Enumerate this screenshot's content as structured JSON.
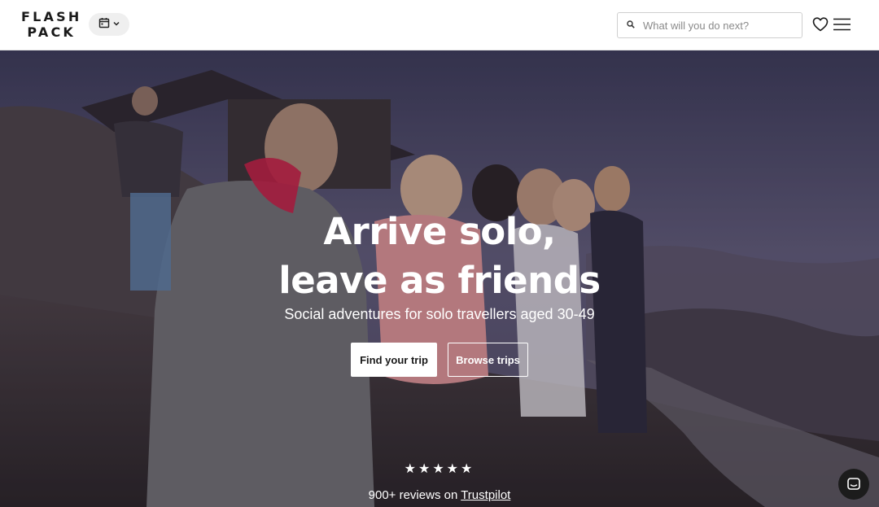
{
  "header": {
    "logo": {
      "line1": "FLASH",
      "line2": "PACK"
    },
    "calendar_icon": "calendar-icon",
    "chevron_icon": "chevron-down-icon",
    "search": {
      "placeholder": "What will you do next?",
      "value": "",
      "icon": "search-icon"
    },
    "wishlist_icon": "heart-icon",
    "menu_icon": "hamburger-menu-icon"
  },
  "hero": {
    "title_line1": "Arrive solo,",
    "title_line2": "leave as friends",
    "subtitle": "Social adventures for solo travellers aged 30-49",
    "primary_button": "Find your trip",
    "secondary_button": "Browse trips",
    "rating_stars": "★★★★★",
    "rating": 5,
    "reviews_prefix": "900+ reviews on ",
    "reviews_link": "Trustpilot"
  },
  "chat_icon": "chat-icon",
  "colors": {
    "header_bg": "#ffffff",
    "text_dark": "#1a1a1a",
    "hero_text": "#ffffff"
  }
}
